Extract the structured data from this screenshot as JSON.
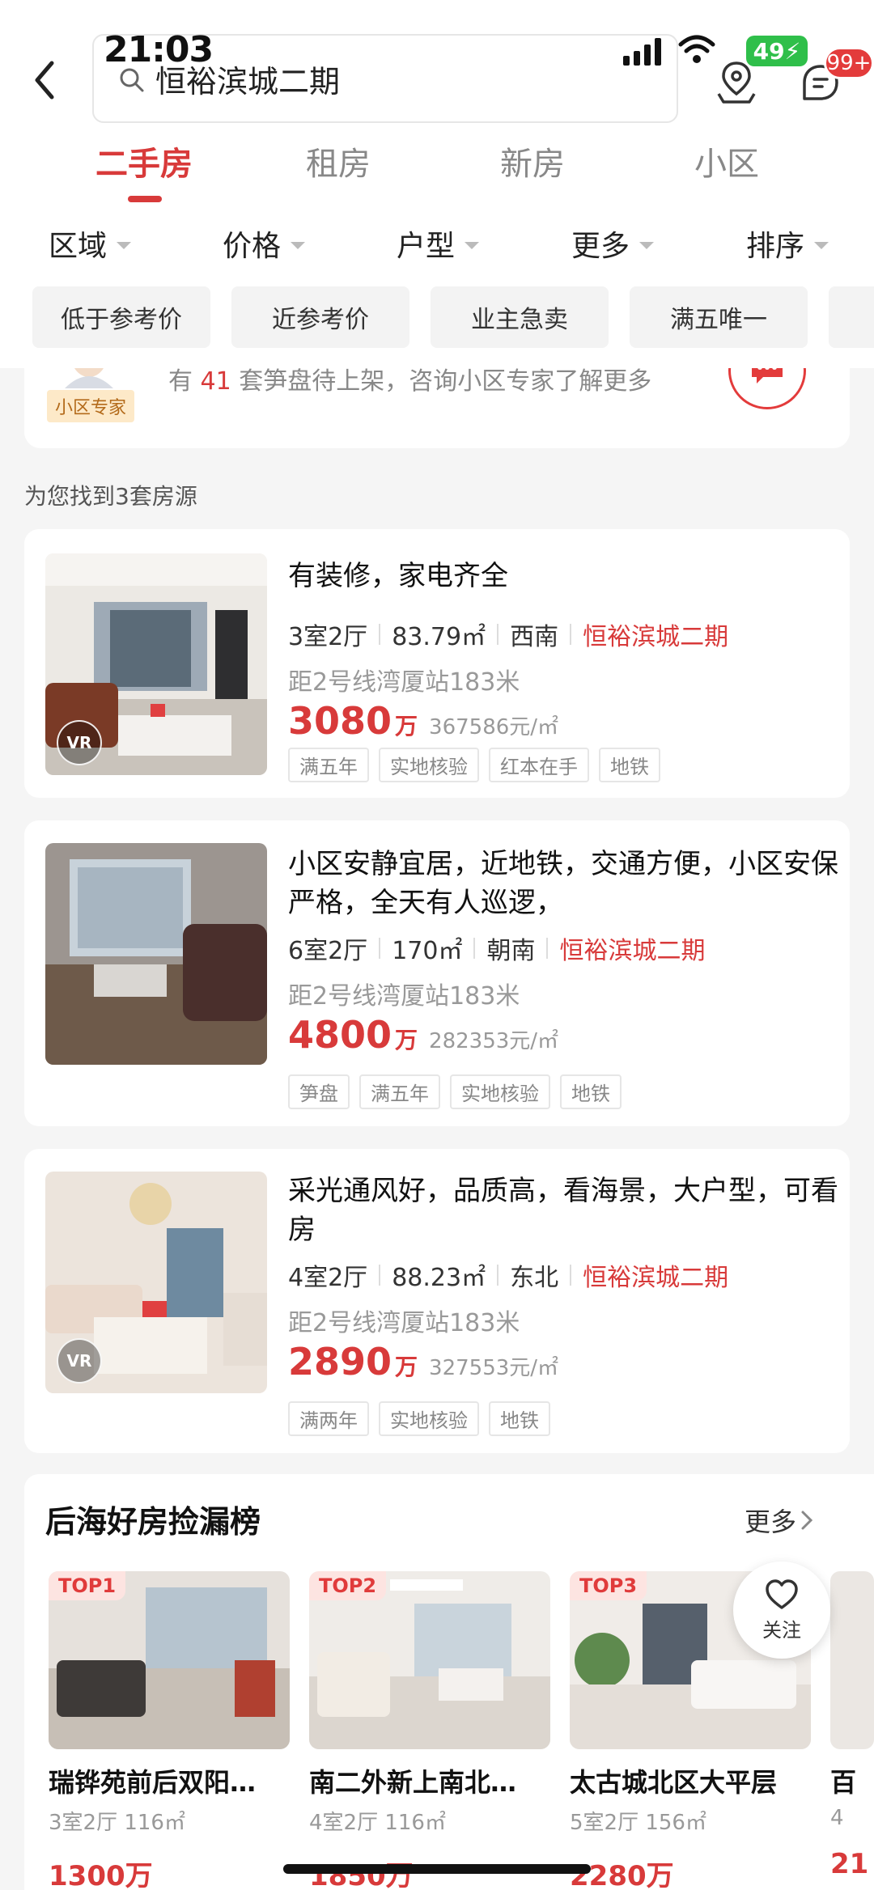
{
  "status": {
    "time": "21:03",
    "battery": "49"
  },
  "search": {
    "value": "恒裕滨城二期"
  },
  "header": {
    "badge": "99+"
  },
  "tabs": [
    {
      "label": "二手房",
      "active": true
    },
    {
      "label": "租房",
      "active": false
    },
    {
      "label": "新房",
      "active": false
    },
    {
      "label": "小区",
      "active": false
    }
  ],
  "filters": [
    "区域",
    "价格",
    "户型",
    "更多",
    "排序"
  ],
  "chips": [
    "低于参考价",
    "近参考价",
    "业主急卖",
    "满五唯一"
  ],
  "expert": {
    "tag": "小区专家",
    "prefix": "有",
    "count": "41",
    "suffix": "套笋盘待上架，咨询小区专家了解更多"
  },
  "result_count": "为您找到3套房源",
  "listings": [
    {
      "title": "有装修，家电齐全",
      "layout": "3室2厅",
      "area": "83.79㎡",
      "orientation": "西南",
      "community": "恒裕滨城二期",
      "distance": "距2号线湾厦站183米",
      "price": "3080",
      "price_unit": "万",
      "unit_price": "367586元/㎡",
      "tags": [
        "满五年",
        "实地核验",
        "红本在手",
        "地铁"
      ],
      "vr": "VR"
    },
    {
      "title": "小区安静宜居，近地铁，交通方便，小区安保严格，全天有人巡逻，",
      "layout": "6室2厅",
      "area": "170㎡",
      "orientation": "朝南",
      "community": "恒裕滨城二期",
      "distance": "距2号线湾厦站183米",
      "price": "4800",
      "price_unit": "万",
      "unit_price": "282353元/㎡",
      "tags": [
        "笋盘",
        "满五年",
        "实地核验",
        "地铁"
      ]
    },
    {
      "title": "采光通风好，品质高，看海景，大户型，可看房",
      "layout": "4室2厅",
      "area": "88.23㎡",
      "orientation": "东北",
      "community": "恒裕滨城二期",
      "distance": "距2号线湾厦站183米",
      "price": "2890",
      "price_unit": "万",
      "unit_price": "327553元/㎡",
      "tags": [
        "满两年",
        "实地核验",
        "地铁"
      ],
      "vr": "VR"
    }
  ],
  "ranking": {
    "title": "后海好房捡漏榜",
    "more": "更多",
    "follow": "关注",
    "items": [
      {
        "badge": "TOP1",
        "name": "瑞铧苑前后双阳…",
        "spec": "3室2厅 116㎡",
        "price": "1300万"
      },
      {
        "badge": "TOP2",
        "name": "南二外新上南北…",
        "spec": "4室2厅 116㎡",
        "price": "1850万"
      },
      {
        "badge": "TOP3",
        "name": "太古城北区大平层",
        "spec": "5室2厅 156㎡",
        "price": "2280万"
      },
      {
        "badge": "",
        "name": "百",
        "spec": "4",
        "price": "21"
      }
    ]
  }
}
